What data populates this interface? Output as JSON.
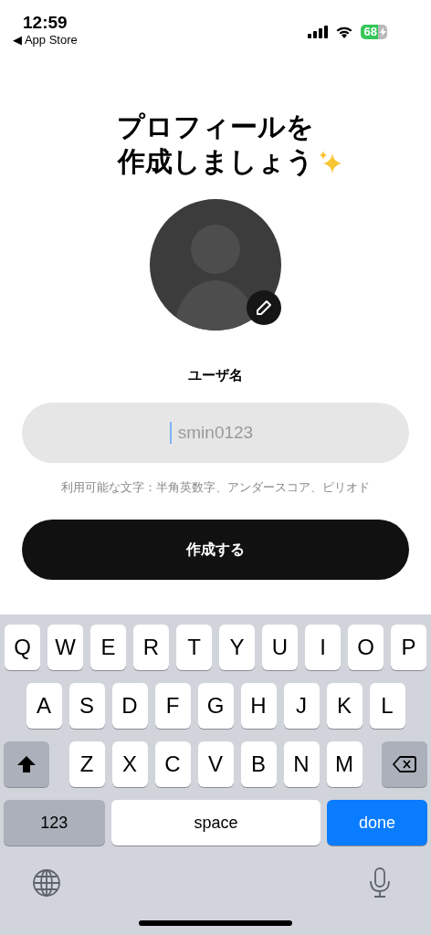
{
  "status_bar": {
    "time": "12:59",
    "back_label": "◀ App Store",
    "battery": "68"
  },
  "title": [
    "プロフィールを",
    "作成しましょう"
  ],
  "username": {
    "label": "ユーザ名",
    "placeholder": "smin0123",
    "hint": "利用可能な文字：半角英数字、アンダースコア、ピリオド"
  },
  "submit_button": "作成する",
  "keyboard": {
    "rows": [
      [
        "Q",
        "W",
        "E",
        "R",
        "T",
        "Y",
        "U",
        "I",
        "O",
        "P"
      ],
      [
        "A",
        "S",
        "D",
        "F",
        "G",
        "H",
        "J",
        "K",
        "L"
      ],
      [
        "Z",
        "X",
        "C",
        "V",
        "B",
        "N",
        "M"
      ]
    ],
    "numbers_key": "123",
    "space_key": "space",
    "done_key": "done"
  }
}
